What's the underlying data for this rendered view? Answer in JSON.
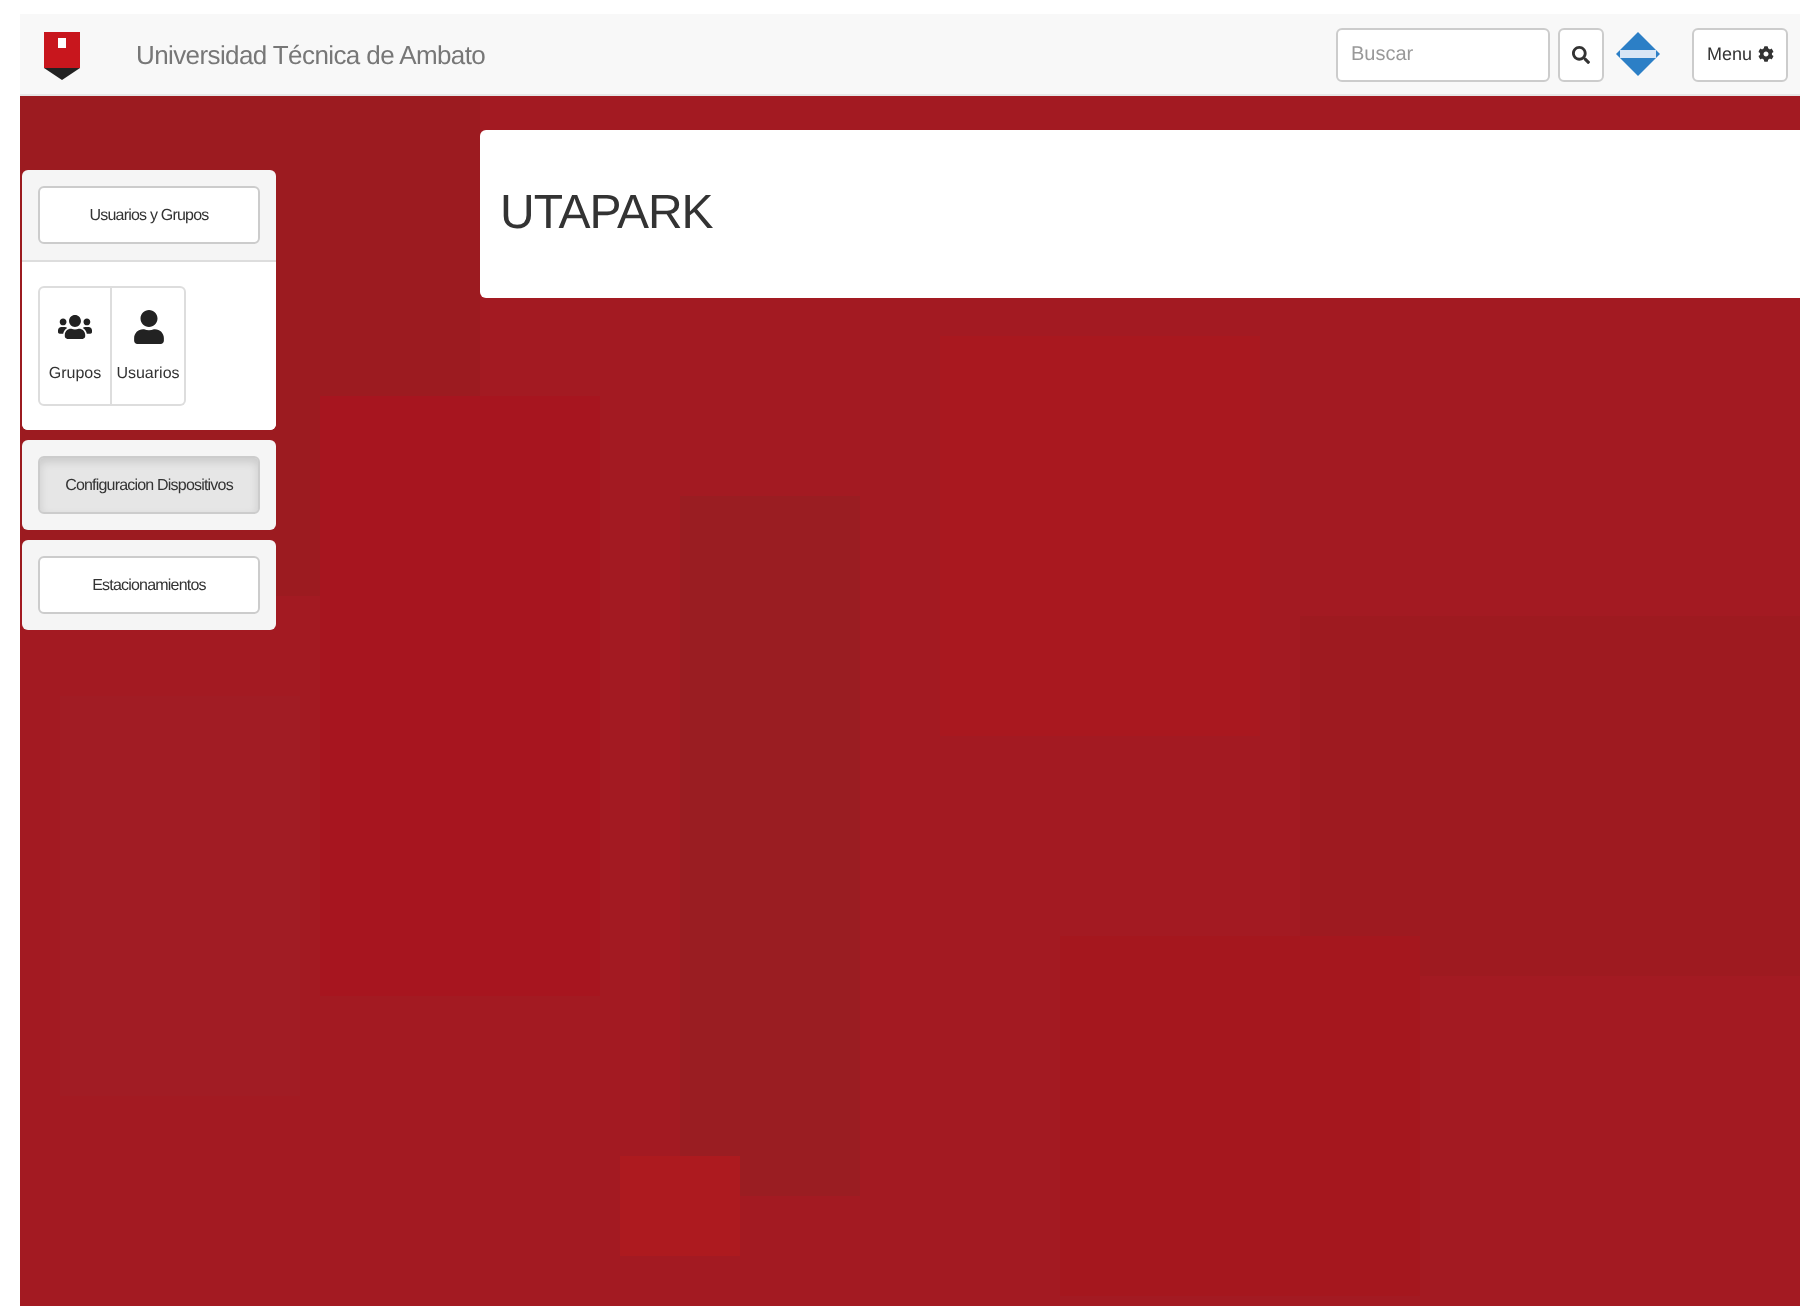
{
  "navbar": {
    "brand": "Universidad Técnica de Ambato",
    "search": {
      "placeholder": "Buscar"
    },
    "menu_button": "Menu"
  },
  "sidebar": [
    {
      "title": "Usuarios y Grupos",
      "selected": false,
      "items": [
        {
          "label": "Grupos",
          "kind": "group"
        },
        {
          "label": "Usuarios",
          "kind": "user"
        }
      ]
    },
    {
      "title": "Configuracion Dispositivos",
      "selected": true
    },
    {
      "title": "Estacionamientos",
      "selected": false
    }
  ],
  "content": {
    "title": "UTAPARK"
  }
}
